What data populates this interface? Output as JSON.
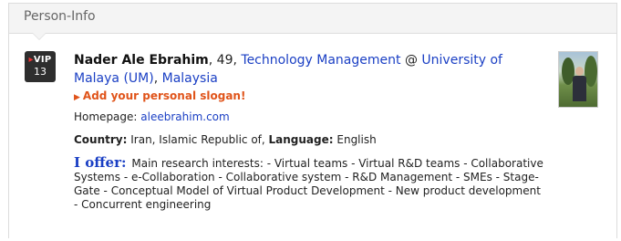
{
  "panel": {
    "title": "Person-Info"
  },
  "vip": {
    "label": "VIP",
    "number": "13"
  },
  "person": {
    "name": "Nader Ale Ebrahim",
    "age_sep": ", 49, ",
    "field": "Technology Management",
    "at": " @ ",
    "university": "University of Malaya (UM)",
    "comma": ", ",
    "country_link": "Malaysia"
  },
  "slogan": "Add your personal slogan!",
  "homepage": {
    "label": "Homepage: ",
    "url": "aleebrahim.com"
  },
  "country": {
    "label": "Country:",
    "value": " Iran, Islamic Republic of, ",
    "language_label": "Language:",
    "language_value": " English"
  },
  "offer": {
    "label": "I offer:",
    "text": "Main research interests: - Virtual teams - Virtual R&D teams - Collaborative Systems - e-Collaboration - Collaborative system - R&D Management - SMEs - Stage-Gate - Conceptual Model of Virtual Product Development - New product development - Concurrent engineering"
  },
  "icons": {
    "vip": "vip-badge-icon",
    "photo": "profile-photo",
    "slogan_arrow": "triangle-right-icon"
  }
}
